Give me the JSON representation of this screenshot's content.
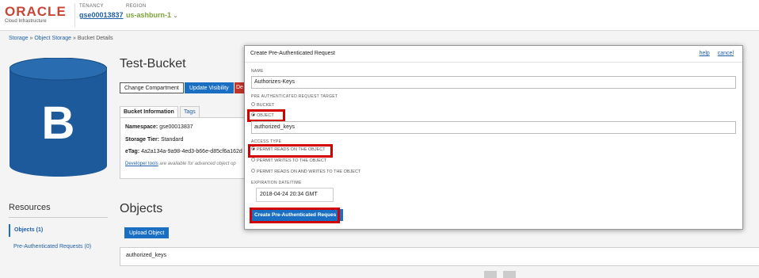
{
  "header": {
    "logo_word": "ORACLE",
    "logo_sub": "Cloud Infrastructure",
    "tenancy_label": "TENANCY",
    "tenancy_value": "gse00013837",
    "region_label": "REGION",
    "region_value": "us-ashburn-1",
    "region_chevron": "⌄"
  },
  "breadcrumb": {
    "storage": "Storage",
    "sep": "»",
    "object_storage": "Object Storage",
    "current": "Bucket Details"
  },
  "bucket": {
    "icon_letter": "B",
    "title": "Test-Bucket",
    "buttons": {
      "change_compartment": "Change Compartment",
      "update_visibility": "Update Visibility",
      "delete": "De"
    },
    "tabs": {
      "info": "Bucket Information",
      "tags": "Tags"
    },
    "info": {
      "namespace_label": "Namespace:",
      "namespace_value": "gse00013837",
      "tier_label": "Storage Tier:",
      "tier_value": "Standard",
      "etag_label": "eTag:",
      "etag_value": "4a2a134a-9a98-4ed3-b66e-d85cf6a162d",
      "devtools_link": "Developer tools",
      "devtools_text": "are available for advanced object op"
    }
  },
  "resources": {
    "heading": "Resources",
    "items": [
      "Objects (1)",
      "Pre-Authenticated Requests (0)"
    ]
  },
  "objects": {
    "heading": "Objects",
    "upload_button": "Upload Object",
    "rows": [
      "authorized_keys"
    ]
  },
  "dialog": {
    "title": "Create Pre-Authenticated Request",
    "help": "help",
    "cancel": "cancel",
    "name_label": "NAME",
    "name_value": "Authorizes-Keys",
    "target_label": "PRE AUTHENTICATED REQUEST TARGET",
    "target_options": [
      "BUCKET",
      "OBJECT"
    ],
    "object_value": "authorized_keys",
    "access_label": "ACCESS TYPE",
    "access_options": [
      "PERMIT READS ON THE OBJECT",
      "PERMIT WRITES TO THE OBJECT",
      "PERMIT READS ON AND WRITES TO THE OBJECT"
    ],
    "expiration_label": "EXPIRATION DATE/TIME",
    "expiration_value": "2018-04-24 20:34 GMT",
    "create_button": "Create Pre-Authenticated Reques",
    "highlight_color": "#d30000"
  },
  "colors": {
    "brand_red": "#c74634",
    "accent_blue": "#1b6fc2",
    "bucket_blue": "#1d5a9c"
  }
}
